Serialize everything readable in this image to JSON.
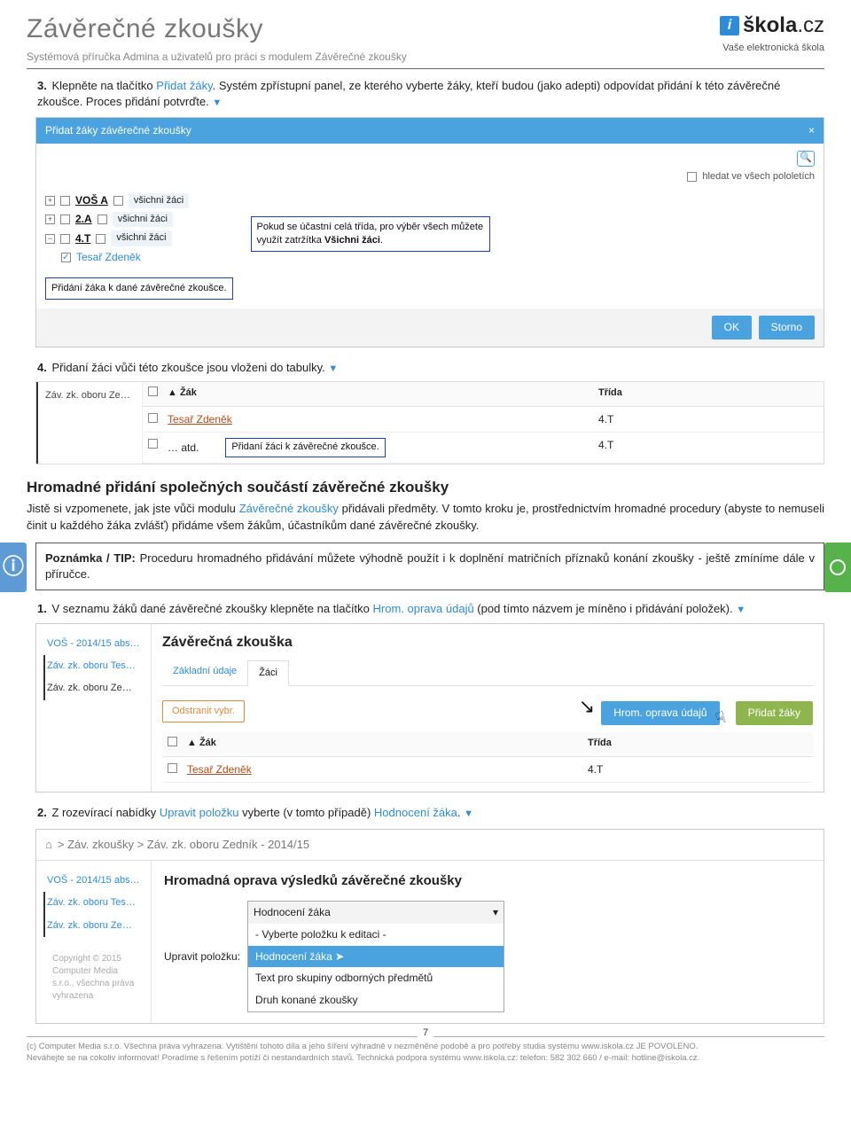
{
  "header": {
    "title": "Závěrečné zkoušky",
    "subtitle": "Systémová příručka Admina a uživatelů pro práci s modulem Závěrečné zkoušky",
    "logo_brand": "škola",
    "logo_domain": ".cz",
    "logo_tag": "Vaše elektronická škola"
  },
  "step3": {
    "num": "3.",
    "t1": "Klepněte na tlačítko ",
    "link": "Přidat žáky",
    "t2": ". Systém zpřístupní panel, ze kterého vyberte žáky, kteří budou (jako adepti) odpovídat přidání k této závěrečné zkoušce. Proces přidání potvrďte."
  },
  "panel1": {
    "title": "Přidat žáky závěrečné zkoušky",
    "search_label": "hledat ve všech pololetích",
    "classes": [
      {
        "toggle": "+",
        "name": "VOŠ A",
        "all": "všichni žáci"
      },
      {
        "toggle": "+",
        "name": "2.A",
        "all": "všichni žáci"
      },
      {
        "toggle": "−",
        "name": "4.T",
        "all": "všichni žáci"
      }
    ],
    "student": "Tesař Zdeněk",
    "callout1": "Pokud se účastní celá třída, pro výběr všech můžete využít zatržítka ",
    "callout1b": "Všichni žáci",
    "callout1c": ".",
    "callout2": "Přidání žáka k dané závěrečné zkoušce.",
    "btn_ok": "OK",
    "btn_cancel": "Storno"
  },
  "step4": {
    "num": "4.",
    "text": "Přidaní žáci vůči této zkoušce jsou vloženi do tabulky."
  },
  "table1": {
    "side": "Záv. zk. oboru Ze…",
    "h_zak": "Žák",
    "h_trida": "Třída",
    "rows": [
      {
        "zak": "Tesař Zdeněk",
        "trida": "4.T"
      },
      {
        "zak": "… atd.",
        "trida": "4.T"
      }
    ],
    "callout": "Přidaní žáci k závěrečné zkoušce."
  },
  "section_h": "Hromadné přidání společných součástí závěrečné zkoušky",
  "section_p1a": "Jistě si vzpomenete, jak jste vůči modulu ",
  "section_p1_link": "Závěrečné zkoušky",
  "section_p1b": " přidávali předměty. V tomto kroku je, prostřednictvím hromadné procedury (abyste to nemuseli činit u každého žáka zvlášť) přidáme všem žákům, účastníkům dané závěrečné zkoušky.",
  "info": {
    "label": "Poznámka / TIP:",
    "text": " Proceduru hromadného přidávání můžete výhodně použít i k doplnění matričních příznaků konání zkoušky - ještě zmíníme dále v příručce."
  },
  "step_b1": {
    "num": "1.",
    "t1": "V seznamu žáků dané závěrečné zkoušky klepněte na tlačítko ",
    "link": "Hrom. oprava údajů",
    "t2": " (pod tímto názvem je míněno i přidávání položek)."
  },
  "shot3": {
    "side": [
      "VOŠ - 2014/15 abs…",
      "Záv. zk. oboru Tes…",
      "Záv. zk. oboru Ze…"
    ],
    "title": "Závěrečná zkouška",
    "tabs": [
      "Základní údaje",
      "Žáci"
    ],
    "btn_remove": "Odstranit vybr.",
    "btn_hrom": "Hrom. oprava údajů",
    "btn_add": "Přidat žáky",
    "th_zak": "Žák",
    "th_trida": "Třída",
    "row_zak": "Tesař Zdeněk",
    "row_trida": "4.T"
  },
  "step_b2": {
    "num": "2.",
    "t1": "Z rozevírací nabídky ",
    "link1": "Upravit položku",
    "t2": " vyberte (v tomto případě) ",
    "link2": "Hodnocení žáka",
    "t3": "."
  },
  "shot4": {
    "crumb": " > Záv. zkoušky > Záv. zk. oboru Zedník - 2014/15",
    "side": [
      "VOŠ - 2014/15 abs…",
      "Záv. zk. oboru Tes…",
      "Záv. zk. oboru Ze…"
    ],
    "title": "Hromadná oprava výsledků závěrečné zkoušky",
    "lbl": "Upravit položku:",
    "selected": "Hodnocení žáka",
    "opts": [
      "- Vyberte položku k editaci -",
      "Hodnocení žáka",
      "Text pro skupiny odborných předmětů",
      "Druh konané zkoušky"
    ],
    "copyright": "Copyright © 2015 Computer Media s.r.o., všechna práva vyhrazena"
  },
  "pagenum": "7",
  "footer1": "(c) Computer Media s.r.o. Všechna práva vyhrazena. Vytištění tohoto díla a jeho šíření výhradně v nezměněné podobě a pro potřeby studia systému www.iskola.cz JE POVOLENO.",
  "footer2": "Neváhejte se na cokoliv informovat! Poradíme s řešením potíží či nestandardních stavů. Technická podpora systému www.iskola.cz: telefon: 582 302 660 / e-mail: hotline@iskola.cz."
}
